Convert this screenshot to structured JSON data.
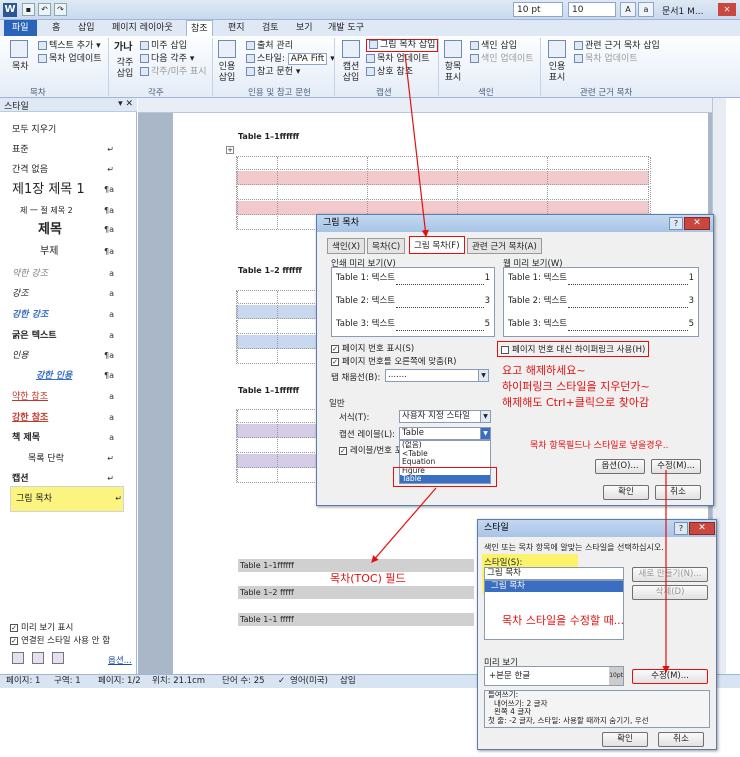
{
  "titlebar": {
    "font_size": "10 pt",
    "font_size2": "10",
    "doc_title": "문서1 M..."
  },
  "tabs": [
    "파일",
    "홈",
    "삽입",
    "페이지 레이아웃",
    "참조",
    "편지",
    "검토",
    "보기",
    "개발 도구"
  ],
  "ribbon": {
    "toc": {
      "big": "목차",
      "add_text": "텍스트 추가",
      "update": "목차 업데이트",
      "group": "목차"
    },
    "footnote": {
      "big1": "가나",
      "big2": "각주 삽입",
      "insert_endnote": "미주 삽입",
      "next_footnote": "다음 각주",
      "show_notes": "각주/미주 표시",
      "group": "각주"
    },
    "citation": {
      "big": "인용 삽입",
      "manage": "출처 관리",
      "style_label": "스타일:",
      "style_value": "APA Fift",
      "bibliography": "참고 문헌",
      "group": "인용 및 참고 문헌"
    },
    "caption": {
      "big": "캡션 삽입",
      "insert_tof": "그림 목차 삽입",
      "update_table": "목차 업데이트",
      "cross_ref": "상호 참조",
      "group": "캡션"
    },
    "index": {
      "big": "항목 표시",
      "insert_index": "색인 삽입",
      "update_index": "색인 업데이트",
      "group": "색인"
    },
    "toa": {
      "big": "인용 표시",
      "insert_toa": "관련 근거 목차 삽입",
      "update_toa": "목차 업데이트",
      "group": "관련 근거 목차"
    }
  },
  "stylepane": {
    "title": "스타일",
    "items": [
      {
        "label": "모두 지우기",
        "mark": ""
      },
      {
        "label": "표준",
        "mark": "↵"
      },
      {
        "label": "간격 없음",
        "mark": "↵"
      },
      {
        "label": "제1장  제목 1",
        "mark": "¶a"
      },
      {
        "label": "제 一 절  제목 2",
        "mark": "¶a"
      },
      {
        "label": "제목",
        "mark": "¶a"
      },
      {
        "label": "부제",
        "mark": "¶a"
      },
      {
        "label": "약한 강조",
        "mark": "a"
      },
      {
        "label": "강조",
        "mark": "a"
      },
      {
        "label": "강한 강조",
        "mark": "a"
      },
      {
        "label": "굵은 텍스트",
        "mark": "a"
      },
      {
        "label": "인용",
        "mark": "¶a"
      },
      {
        "label": "강한 인용",
        "mark": "¶a"
      },
      {
        "label": "약한 참조",
        "mark": "a"
      },
      {
        "label": "강한 참조",
        "mark": "a"
      },
      {
        "label": "책 제목",
        "mark": "a"
      },
      {
        "label": "목록 단락",
        "mark": "↵"
      },
      {
        "label": "캡션",
        "mark": "↵"
      },
      {
        "label": "그림 목차",
        "mark": "↵"
      }
    ],
    "show_preview": "미리 보기 표시",
    "disable_linked": "연결된 스타일 사용 안 함",
    "options": "옵션..."
  },
  "document": {
    "caption1": "Table 1–1ffffff",
    "caption2": "Table 1–2 ffffff",
    "caption3": "Table 1–1ffffff",
    "toc1": "Table 1–1ffffff",
    "toc2": "Table 1–2 fffff",
    "toc3": "Table 1–1 fffff"
  },
  "status": {
    "page": "페이지: 1",
    "section": "구역: 1",
    "pages": "페이지: 1/2",
    "pos": "위치: 21.1cm",
    "words": "단어 수: 25",
    "lang": "영어(미국)",
    "mode": "삽입"
  },
  "tofdialog": {
    "title": "그림 목차",
    "tabs": [
      "색인(X)",
      "목차(C)",
      "그림 목차(F)",
      "관련 근거 목차(A)"
    ],
    "print_preview_label": "인쇄 미리 보기(V)",
    "print_lines": [
      {
        "t": "Table 1:  텍스트",
        "n": "1"
      },
      {
        "t": "Table 2:  텍스트",
        "n": "3"
      },
      {
        "t": "Table 3:  텍스트",
        "n": "5"
      }
    ],
    "web_preview_label": "웹 미리 보기(W)",
    "web_lines": [
      {
        "t": "Table 1:  텍스트",
        "n": "1"
      },
      {
        "t": "Table 2:  텍스트",
        "n": "3"
      },
      {
        "t": "Table 3:  텍스트",
        "n": "5"
      }
    ],
    "show_page_numbers": "페이지 번호 표시(S)",
    "right_align": "페이지 번호를 오른쪽에 맞춤(R)",
    "tab_leader_label": "탭 채움선(B):",
    "tab_leader_value": ".......",
    "use_hyperlinks": "페이지 번호 대신 하이퍼링크 사용(H)",
    "general": "일반",
    "format_label": "서식(T):",
    "format_value": "사용자 지정 스타일",
    "caption_label": "캡션 레이블(L):",
    "caption_value": "Table",
    "include_label": "레이블/번호 포함",
    "caption_options": [
      "(없음)",
      "<Table",
      "Equation",
      "Figure",
      "Table"
    ],
    "options_btn": "옵션(O)...",
    "modify_btn": "수정(M)...",
    "ok": "확인",
    "cancel": "취소"
  },
  "styledialog": {
    "title": "스타일",
    "desc": "색인 또는 목차 항목에 알맞는 스타일을 선택하십시오.",
    "styles_label": "스타일(S):",
    "selected": "그림 목차",
    "list_item": "그림 목차",
    "new_btn": "새로 만들기(N)...",
    "delete_btn": "삭제(D)",
    "preview_label": "미리 보기",
    "preview_text": "+본문 한글",
    "preview_size": "10pt",
    "modify_btn": "수정(M)...",
    "desc_l1": "들여쓰기:",
    "desc_l2": "내어쓰기:  2 글자",
    "desc_l3": "왼쪽  4 글자",
    "desc_l4": "첫 줄:  -2 글자, 스타일: 사용할 때까지 숨기기, 우선",
    "ok": "확인",
    "cancel": "취소"
  },
  "annotations": {
    "a1": "요고 해제하세요~",
    "a2": "하이퍼링크 스타일을 지우던가~",
    "a3": "해제해도 Ctrl+클릭으로 찾아감",
    "a4": "목차 항목필드나 스타일로 넣을경우..",
    "a5": "목차(TOC) 필드",
    "a6": "목차 스타일을 수정할 때..."
  }
}
